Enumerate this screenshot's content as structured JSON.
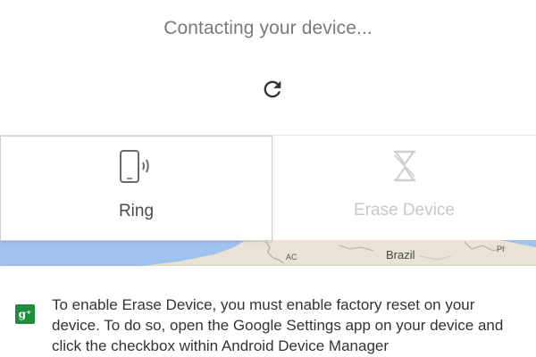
{
  "status": {
    "title": "Contacting your device...",
    "refresh_icon": "refresh-icon"
  },
  "actions": {
    "ring": {
      "label": "Ring",
      "icon": "phone-ring-icon",
      "enabled": true
    },
    "erase": {
      "label": "Erase Device",
      "icon": "erase-hourglass-icon",
      "enabled": false
    }
  },
  "map": {
    "places": [
      "AC",
      "Brazil",
      "PI"
    ]
  },
  "info": {
    "icon": "google-settings-icon",
    "icon_text": "g⁺",
    "message": "To enable Erase Device, you must enable factory reset on your device. To do so, open the Google Settings app on your device and click the checkbox within Android Device Manager"
  },
  "colors": {
    "status_text": "#7a7a7a",
    "ring_label": "#4a4a4a",
    "erase_label_disabled": "#c8c8c8",
    "settings_icon_bg": "#1e8e3e",
    "map_land": "#e8e3d4",
    "map_water": "#9fc2ee"
  }
}
